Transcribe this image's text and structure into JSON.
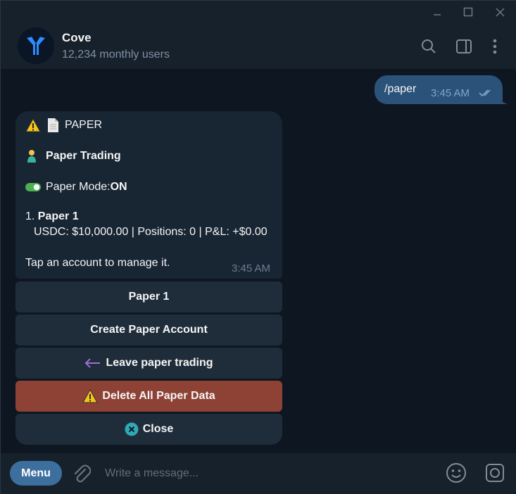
{
  "header": {
    "title": "Cove",
    "subtitle": "12,234 monthly users"
  },
  "messages": {
    "outgoing": {
      "text": "/paper",
      "time": "3:45 AM"
    },
    "incoming": {
      "line_header": "PAPER",
      "line_trading": "Paper Trading",
      "mode_label": "Paper Mode: ",
      "mode_value": "ON",
      "account_index": "1. ",
      "account_name": "Paper 1",
      "account_details": "USDC: $10,000.00 | Positions: 0 | P&L: +$0.00",
      "footer": "Tap an account to manage it.",
      "time": "3:45 AM"
    }
  },
  "keyboard": {
    "buttons": [
      {
        "label": "Paper 1"
      },
      {
        "label": "Create Paper Account"
      },
      {
        "label": "Leave paper trading",
        "icon": "arrow-left-icon"
      },
      {
        "label": "Delete All Paper Data",
        "icon": "warning-icon"
      },
      {
        "label": "Close",
        "icon": "close-circle-icon"
      }
    ]
  },
  "composer": {
    "menu_label": "Menu",
    "placeholder": "Write a message..."
  },
  "colors": {
    "accent": "#3d6f9e",
    "outgoing_bubble": "#2b5278",
    "incoming_bubble": "#182533",
    "danger": "#8e4236"
  }
}
